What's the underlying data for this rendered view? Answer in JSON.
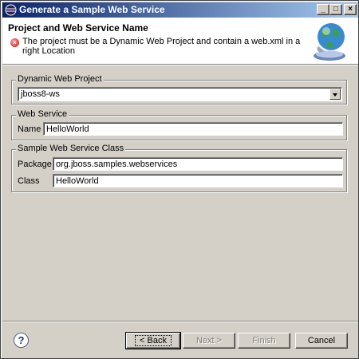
{
  "window": {
    "title": "Generate a Sample Web Service",
    "minimize_glyph": "_",
    "maximize_glyph": "□",
    "close_glyph": "×"
  },
  "header": {
    "title": "Project and Web Service Name",
    "message": "The project must be a Dynamic Web Project and contain a web.xml in a right Location",
    "error_icon_glyph": "×"
  },
  "dynamic_project": {
    "label": "Dynamic Web Project",
    "selected": "jboss8-ws"
  },
  "web_service": {
    "label": "Web Service",
    "name_label": "Name",
    "name_value": "HelloWorld"
  },
  "sample_class": {
    "label": "Sample Web Service Class",
    "package_label": "Package",
    "package_value": "org.jboss.samples.webservices",
    "class_label": "Class",
    "class_value": "HelloWorld"
  },
  "buttons": {
    "help": "?",
    "back": "< Back",
    "next": "Next >",
    "finish": "Finish",
    "cancel": "Cancel"
  },
  "colors": {
    "titlebar_start": "#0a246a",
    "titlebar_end": "#a6caf0",
    "dialog_bg": "#d4d0c8",
    "error": "#d01010"
  }
}
